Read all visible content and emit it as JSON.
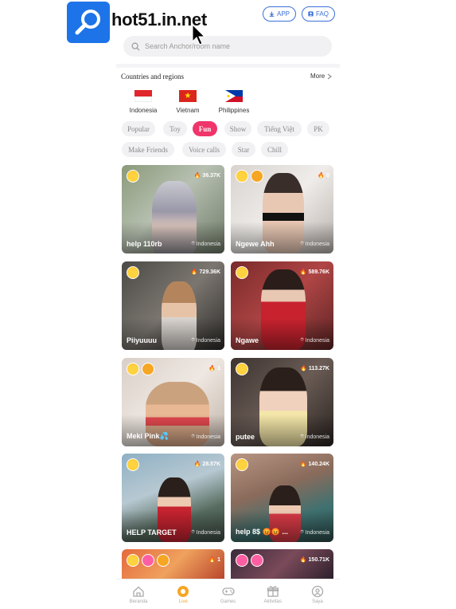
{
  "watermark": {
    "text": "hot51.in.net",
    "icon": "magnifier-icon"
  },
  "header": {
    "app_label": "APP",
    "faq_label": "FAQ"
  },
  "search": {
    "placeholder": "Search Anchor/room name"
  },
  "regions": {
    "title": "Countries and regions",
    "more_label": "More",
    "countries": [
      {
        "label": "Indonesia",
        "flag": "flag-indonesia"
      },
      {
        "label": "Vietnam",
        "flag": "flag-vietnam"
      },
      {
        "label": "Philippines",
        "flag": "flag-philippines"
      }
    ]
  },
  "categories": [
    {
      "label": "Popular",
      "active": false
    },
    {
      "label": "Toy",
      "active": false
    },
    {
      "label": "Fun",
      "active": true
    },
    {
      "label": "Show",
      "active": false
    },
    {
      "label": "Tiếng Việt",
      "active": false
    },
    {
      "label": "PK",
      "active": false
    },
    {
      "label": "Make Friends",
      "active": false
    },
    {
      "label": "Voice calls",
      "active": false
    },
    {
      "label": "Star",
      "active": false
    },
    {
      "label": "Chill",
      "active": false
    }
  ],
  "streams": [
    {
      "name": "help 110rb",
      "views": "36.37K",
      "location": "Indonesia",
      "badges": [
        "face"
      ]
    },
    {
      "name": "Ngewe Ahh",
      "views": "0",
      "location": "Indonesia",
      "badges": [
        "face",
        "shield"
      ]
    },
    {
      "name": "Piiyuuuu",
      "views": "729.36K",
      "location": "Indonesia",
      "badges": [
        "face"
      ]
    },
    {
      "name": "Ngawe",
      "views": "589.76K",
      "location": "Indonesia",
      "badges": [
        "face"
      ]
    },
    {
      "name": "Meki Pink💦",
      "views": "1",
      "location": "Indonesia",
      "badges": [
        "face",
        "shield"
      ]
    },
    {
      "name": "putee",
      "views": "113.27K",
      "location": "Indonesia",
      "badges": [
        "face"
      ]
    },
    {
      "name": "HELP TARGET",
      "views": "28.57K",
      "location": "Indonesia",
      "badges": [
        "face"
      ]
    },
    {
      "name": "help 8$ 😡😡 ...",
      "views": "140.24K",
      "location": "Indonesia",
      "badges": [
        "face"
      ]
    },
    {
      "name": "",
      "views": "1",
      "location": "",
      "badges": [
        "face",
        "lips",
        "shield"
      ]
    },
    {
      "name": "",
      "views": "150.71K",
      "location": "",
      "badges": [
        "lips",
        "lips"
      ]
    }
  ],
  "tabbar": [
    {
      "label": "Beranda",
      "icon": "home-icon",
      "active": false
    },
    {
      "label": "Live",
      "icon": "live-icon",
      "active": true
    },
    {
      "label": "Games",
      "icon": "gamepad-icon",
      "active": false
    },
    {
      "label": "Aktivitas",
      "icon": "gift-icon",
      "active": false
    },
    {
      "label": "Saya",
      "icon": "profile-icon",
      "active": false
    }
  ],
  "colors": {
    "accent": "#f0356a",
    "brand_blue": "#1d74e8",
    "tab_active": "#f5a623"
  }
}
